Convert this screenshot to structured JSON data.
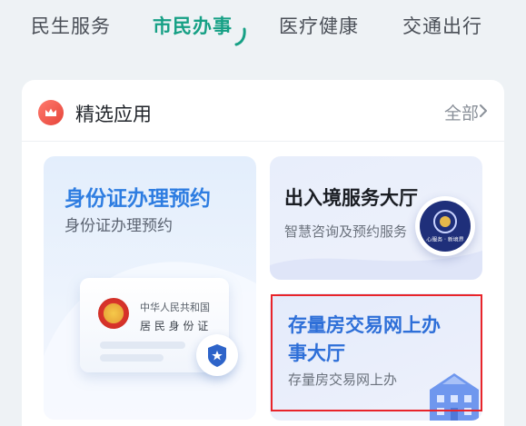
{
  "tabs": [
    {
      "label": "民生服务",
      "active": false
    },
    {
      "label": "市民办事",
      "active": true
    },
    {
      "label": "医疗健康",
      "active": false
    },
    {
      "label": "交通出行",
      "active": false
    }
  ],
  "section": {
    "title": "精选应用",
    "see_all": "全部",
    "icons": {
      "badge": "crown-icon",
      "more": "chevron-right-icon"
    }
  },
  "cards": [
    {
      "title": "身份证办理预约",
      "subtitle": "身份证办理预约",
      "id_card_lines": [
        "中华人民共和国",
        "居 民 身 份 证"
      ],
      "icons": [
        "national-emblem-icon",
        "police-badge-icon"
      ]
    },
    {
      "title": "出入境服务大厅",
      "subtitle": "智慧咨询及预约服务",
      "emblem_text": "心服务 · 新境界",
      "icons": [
        "immigration-emblem-icon"
      ]
    },
    {
      "title": "存量房交易网上办事大厅",
      "subtitle": "存量房交易网上办",
      "icons": [
        "building-icon"
      ]
    }
  ],
  "colors": {
    "accent": "#16a085",
    "card_title_blue": "#2e7de1",
    "highlight": "#e8242a"
  }
}
